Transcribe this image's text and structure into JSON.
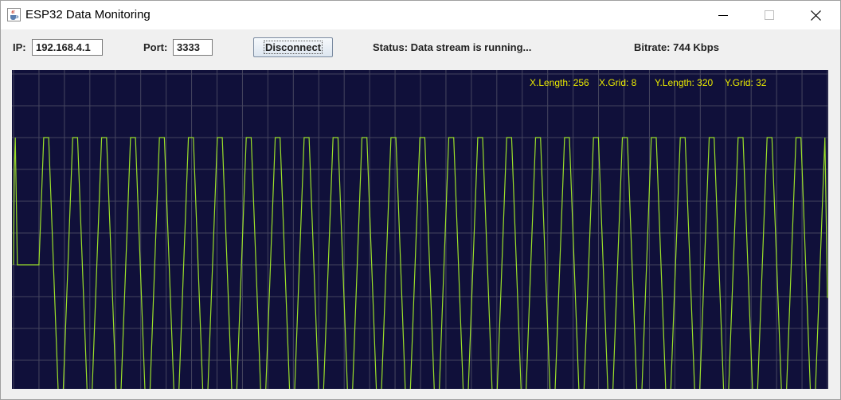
{
  "window": {
    "title": "ESP32 Data Monitoring",
    "app_icon": "java-cup-icon"
  },
  "connection": {
    "ip_label": "IP:",
    "ip_value": "192.168.4.1",
    "port_label": "Port:",
    "port_value": "3333",
    "disconnect_label": "Disconnect",
    "status_text": "Status: Data stream is running...",
    "bitrate_text": "Bitrate: 744 Kbps"
  },
  "scope": {
    "x_length_text": "X.Length: 256",
    "x_grid_text": "X.Grid: 8",
    "y_length_text": "Y.Length: 320",
    "y_grid_text": "Y.Grid: 32",
    "colors": {
      "background": "#10103a",
      "grid": "#45455f",
      "trace": "#9be02a",
      "overlay_text": "#e8e800"
    }
  },
  "chart_data": {
    "type": "line",
    "x_length": 256,
    "x_grid": 8,
    "y_length": 320,
    "y_grid": 32,
    "xlim": [
      0,
      256
    ],
    "ylim": [
      0,
      320
    ],
    "grid": true,
    "signal": {
      "shape": "trapezoid-wave",
      "high": 256,
      "low": 0,
      "period": 9.1,
      "cycles_visible": 28,
      "initial_spike_high": 256,
      "initial_flat_level": 128,
      "initial_flat_until": 8
    }
  }
}
